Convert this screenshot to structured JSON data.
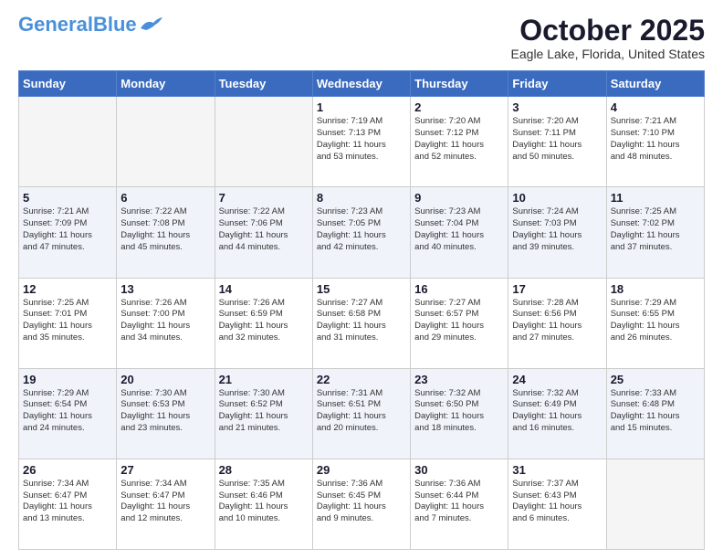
{
  "header": {
    "logo_general": "General",
    "logo_blue": "Blue",
    "month_title": "October 2025",
    "location": "Eagle Lake, Florida, United States"
  },
  "days_of_week": [
    "Sunday",
    "Monday",
    "Tuesday",
    "Wednesday",
    "Thursday",
    "Friday",
    "Saturday"
  ],
  "weeks": [
    [
      {
        "day": "",
        "info": ""
      },
      {
        "day": "",
        "info": ""
      },
      {
        "day": "",
        "info": ""
      },
      {
        "day": "1",
        "info": "Sunrise: 7:19 AM\nSunset: 7:13 PM\nDaylight: 11 hours\nand 53 minutes."
      },
      {
        "day": "2",
        "info": "Sunrise: 7:20 AM\nSunset: 7:12 PM\nDaylight: 11 hours\nand 52 minutes."
      },
      {
        "day": "3",
        "info": "Sunrise: 7:20 AM\nSunset: 7:11 PM\nDaylight: 11 hours\nand 50 minutes."
      },
      {
        "day": "4",
        "info": "Sunrise: 7:21 AM\nSunset: 7:10 PM\nDaylight: 11 hours\nand 48 minutes."
      }
    ],
    [
      {
        "day": "5",
        "info": "Sunrise: 7:21 AM\nSunset: 7:09 PM\nDaylight: 11 hours\nand 47 minutes."
      },
      {
        "day": "6",
        "info": "Sunrise: 7:22 AM\nSunset: 7:08 PM\nDaylight: 11 hours\nand 45 minutes."
      },
      {
        "day": "7",
        "info": "Sunrise: 7:22 AM\nSunset: 7:06 PM\nDaylight: 11 hours\nand 44 minutes."
      },
      {
        "day": "8",
        "info": "Sunrise: 7:23 AM\nSunset: 7:05 PM\nDaylight: 11 hours\nand 42 minutes."
      },
      {
        "day": "9",
        "info": "Sunrise: 7:23 AM\nSunset: 7:04 PM\nDaylight: 11 hours\nand 40 minutes."
      },
      {
        "day": "10",
        "info": "Sunrise: 7:24 AM\nSunset: 7:03 PM\nDaylight: 11 hours\nand 39 minutes."
      },
      {
        "day": "11",
        "info": "Sunrise: 7:25 AM\nSunset: 7:02 PM\nDaylight: 11 hours\nand 37 minutes."
      }
    ],
    [
      {
        "day": "12",
        "info": "Sunrise: 7:25 AM\nSunset: 7:01 PM\nDaylight: 11 hours\nand 35 minutes."
      },
      {
        "day": "13",
        "info": "Sunrise: 7:26 AM\nSunset: 7:00 PM\nDaylight: 11 hours\nand 34 minutes."
      },
      {
        "day": "14",
        "info": "Sunrise: 7:26 AM\nSunset: 6:59 PM\nDaylight: 11 hours\nand 32 minutes."
      },
      {
        "day": "15",
        "info": "Sunrise: 7:27 AM\nSunset: 6:58 PM\nDaylight: 11 hours\nand 31 minutes."
      },
      {
        "day": "16",
        "info": "Sunrise: 7:27 AM\nSunset: 6:57 PM\nDaylight: 11 hours\nand 29 minutes."
      },
      {
        "day": "17",
        "info": "Sunrise: 7:28 AM\nSunset: 6:56 PM\nDaylight: 11 hours\nand 27 minutes."
      },
      {
        "day": "18",
        "info": "Sunrise: 7:29 AM\nSunset: 6:55 PM\nDaylight: 11 hours\nand 26 minutes."
      }
    ],
    [
      {
        "day": "19",
        "info": "Sunrise: 7:29 AM\nSunset: 6:54 PM\nDaylight: 11 hours\nand 24 minutes."
      },
      {
        "day": "20",
        "info": "Sunrise: 7:30 AM\nSunset: 6:53 PM\nDaylight: 11 hours\nand 23 minutes."
      },
      {
        "day": "21",
        "info": "Sunrise: 7:30 AM\nSunset: 6:52 PM\nDaylight: 11 hours\nand 21 minutes."
      },
      {
        "day": "22",
        "info": "Sunrise: 7:31 AM\nSunset: 6:51 PM\nDaylight: 11 hours\nand 20 minutes."
      },
      {
        "day": "23",
        "info": "Sunrise: 7:32 AM\nSunset: 6:50 PM\nDaylight: 11 hours\nand 18 minutes."
      },
      {
        "day": "24",
        "info": "Sunrise: 7:32 AM\nSunset: 6:49 PM\nDaylight: 11 hours\nand 16 minutes."
      },
      {
        "day": "25",
        "info": "Sunrise: 7:33 AM\nSunset: 6:48 PM\nDaylight: 11 hours\nand 15 minutes."
      }
    ],
    [
      {
        "day": "26",
        "info": "Sunrise: 7:34 AM\nSunset: 6:47 PM\nDaylight: 11 hours\nand 13 minutes."
      },
      {
        "day": "27",
        "info": "Sunrise: 7:34 AM\nSunset: 6:47 PM\nDaylight: 11 hours\nand 12 minutes."
      },
      {
        "day": "28",
        "info": "Sunrise: 7:35 AM\nSunset: 6:46 PM\nDaylight: 11 hours\nand 10 minutes."
      },
      {
        "day": "29",
        "info": "Sunrise: 7:36 AM\nSunset: 6:45 PM\nDaylight: 11 hours\nand 9 minutes."
      },
      {
        "day": "30",
        "info": "Sunrise: 7:36 AM\nSunset: 6:44 PM\nDaylight: 11 hours\nand 7 minutes."
      },
      {
        "day": "31",
        "info": "Sunrise: 7:37 AM\nSunset: 6:43 PM\nDaylight: 11 hours\nand 6 minutes."
      },
      {
        "day": "",
        "info": ""
      }
    ]
  ]
}
